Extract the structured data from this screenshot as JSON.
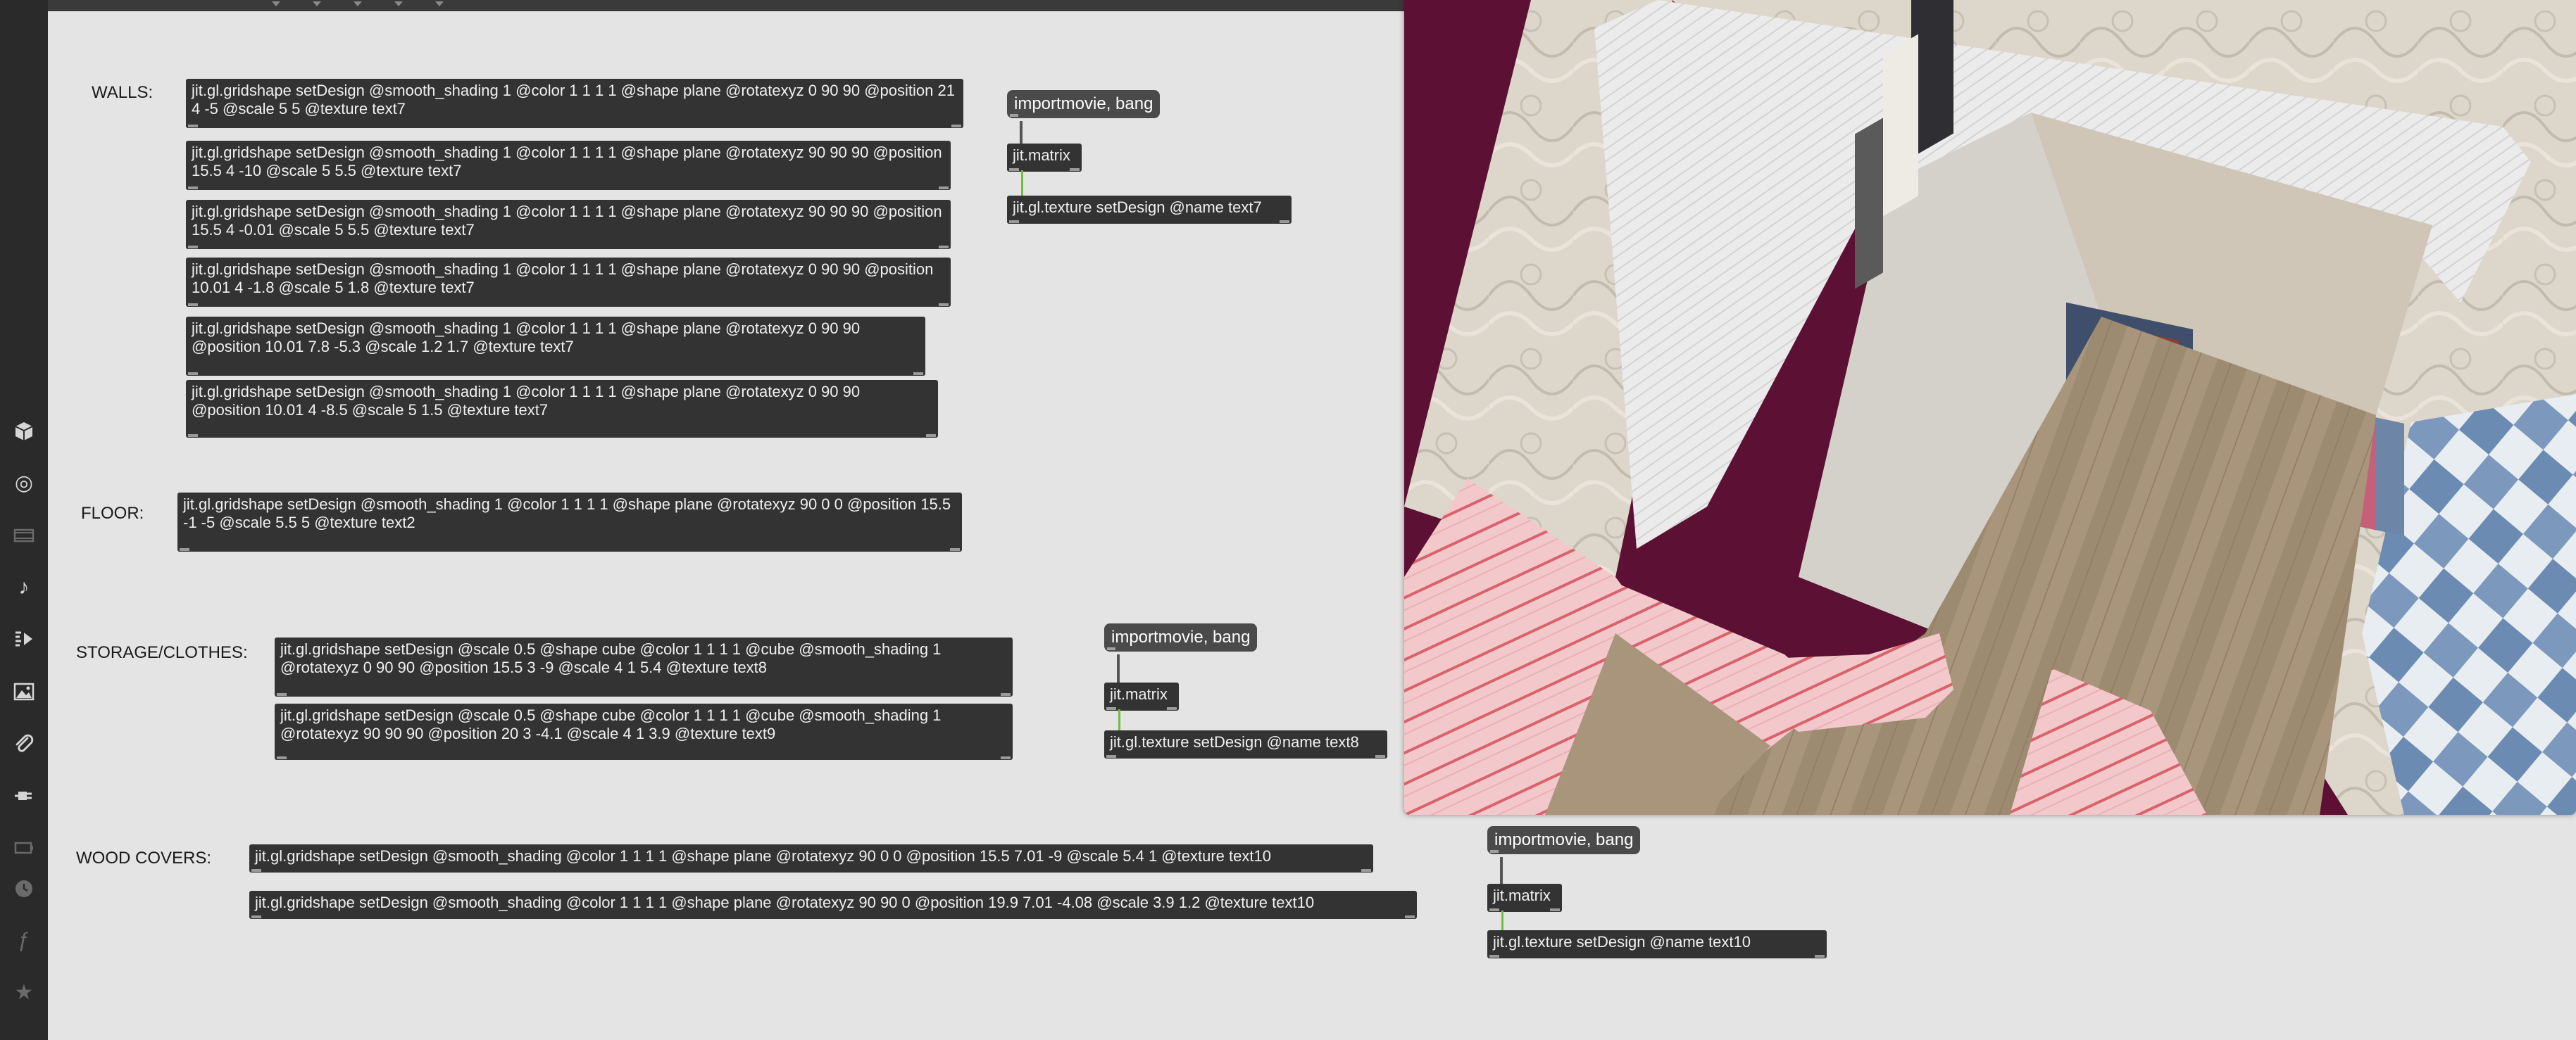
{
  "sidebar": {
    "icons": [
      {
        "name": "cube-icon",
        "glyph": "",
        "enabled": true
      },
      {
        "name": "target-icon",
        "glyph": "◎",
        "enabled": true
      },
      {
        "name": "film-strip-icon",
        "glyph": "",
        "enabled": false
      },
      {
        "name": "music-note-icon",
        "glyph": "♪",
        "enabled": true
      },
      {
        "name": "media-playlist-icon",
        "glyph": "",
        "enabled": true
      },
      {
        "name": "image-icon",
        "glyph": "",
        "enabled": true
      },
      {
        "name": "paperclip-icon",
        "glyph": "",
        "enabled": true
      },
      {
        "name": "plug-icon",
        "glyph": "",
        "enabled": true
      },
      {
        "name": "battery-icon",
        "glyph": "",
        "enabled": false
      },
      {
        "name": "clock-icon",
        "glyph": "",
        "enabled": false
      },
      {
        "name": "italic-f-icon",
        "glyph": "ƒ",
        "enabled": false
      },
      {
        "name": "star-icon",
        "glyph": "★",
        "enabled": false
      }
    ]
  },
  "comments": {
    "walls": "WALLS:",
    "floor": "FLOOR:",
    "storage": "STORAGE/CLOTHES:",
    "wood": "WOOD COVERS:"
  },
  "objects": {
    "walls": [
      "jit.gl.gridshape setDesign @smooth_shading 1 @color 1 1 1 1 @shape plane @rotatexyz 0 90 90 @position 21 4 -5 @scale 5 5 @texture text7",
      "jit.gl.gridshape setDesign @smooth_shading 1 @color 1 1 1 1 @shape plane @rotatexyz 90 90 90 @position 15.5 4 -10 @scale 5 5.5 @texture text7",
      "jit.gl.gridshape setDesign @smooth_shading 1 @color 1 1 1 1 @shape plane @rotatexyz 90 90 90 @position 15.5 4 -0.01 @scale 5 5.5 @texture text7",
      "jit.gl.gridshape setDesign @smooth_shading 1 @color 1 1 1 1 @shape plane @rotatexyz 0 90 90 @position 10.01 4 -1.8 @scale 5 1.8 @texture text7",
      "jit.gl.gridshape setDesign @smooth_shading 1 @color 1 1 1 1 @shape plane @rotatexyz 0 90 90 @position 10.01 7.8 -5.3 @scale 1.2 1.7 @texture text7",
      "jit.gl.gridshape setDesign @smooth_shading 1 @color 1 1 1 1 @shape plane @rotatexyz 0 90 90 @position 10.01 4 -8.5 @scale 5 1.5 @texture text7"
    ],
    "floor": "jit.gl.gridshape setDesign @smooth_shading 1 @color 1 1 1 1 @shape plane @rotatexyz 90 0 0 @position 15.5 -1 -5 @scale 5.5 5 @texture text2",
    "storage": [
      "jit.gl.gridshape setDesign @scale 0.5 @shape cube @color 1 1 1 1 @cube @smooth_shading 1 @rotatexyz 0 90 90 @position 15.5 3 -9 @scale 4 1 5.4 @texture text8",
      "jit.gl.gridshape setDesign @scale 0.5 @shape cube @color 1 1 1 1 @cube @smooth_shading 1 @rotatexyz 90 90 90 @position 20 3 -4.1 @scale 4 1 3.9 @texture text9"
    ],
    "wood": [
      "jit.gl.gridshape setDesign @smooth_shading @color 1 1 1 1 @shape plane @rotatexyz 90 0 0 @position 15.5 7.01 -9 @scale 5.4 1 @texture text10",
      "jit.gl.gridshape setDesign @smooth_shading @color 1 1 1 1 @shape plane @rotatexyz 90 90 0 @position 19.9 7.01 -4.08 @scale 3.9 1.2 @texture text10"
    ],
    "texture_chains": [
      {
        "msg": "importmovie, bang",
        "matrix": "jit.matrix",
        "texture": "jit.gl.texture setDesign @name text7"
      },
      {
        "msg": "importmovie, bang",
        "matrix": "jit.matrix",
        "texture": "jit.gl.texture setDesign @name text8"
      },
      {
        "msg": "importmovie, bang",
        "matrix": "jit.matrix",
        "texture": "jit.gl.texture setDesign @name text10"
      }
    ]
  },
  "colors": {
    "render_bg": "#5c1033",
    "wall_white": "#eeeeee",
    "floor_wood": "#a8957c",
    "wallpaper": "#d9d2c7",
    "pink_fabric": "#f2c4c8",
    "tile_blue": "#6b8bb3"
  }
}
